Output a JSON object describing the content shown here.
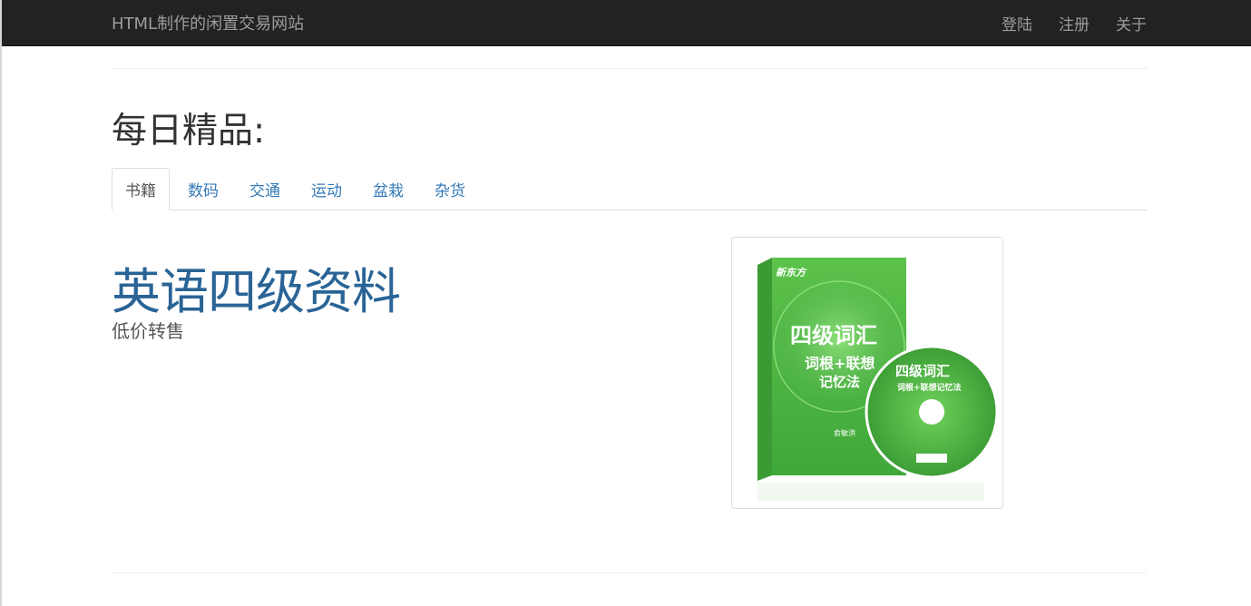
{
  "navbar": {
    "brand": "HTML制作的闲置交易网站",
    "links": [
      "登陆",
      "注册",
      "关于"
    ]
  },
  "main": {
    "title": "每日精品:",
    "tabs": [
      {
        "label": "书籍",
        "active": true
      },
      {
        "label": "数码",
        "active": false
      },
      {
        "label": "交通",
        "active": false
      },
      {
        "label": "运动",
        "active": false
      },
      {
        "label": "盆栽",
        "active": false
      },
      {
        "label": "杂货",
        "active": false
      }
    ],
    "item": {
      "title": "英语四级资料",
      "subtitle": "低价转售",
      "image": {
        "publisher_mark": "新东方",
        "book_title": "四级词汇",
        "book_subtitle": "词根+联想",
        "book_method": "记忆法",
        "author": "俞敏洪",
        "disc_title": "四级词汇",
        "disc_subtitle": "词根+联想记忆法"
      }
    }
  },
  "colors": {
    "navbar_bg": "#222222",
    "nav_text": "#9d9d9d",
    "link": "#337ab7",
    "item_title": "#2a6496",
    "book_green": "#4cae4c"
  }
}
